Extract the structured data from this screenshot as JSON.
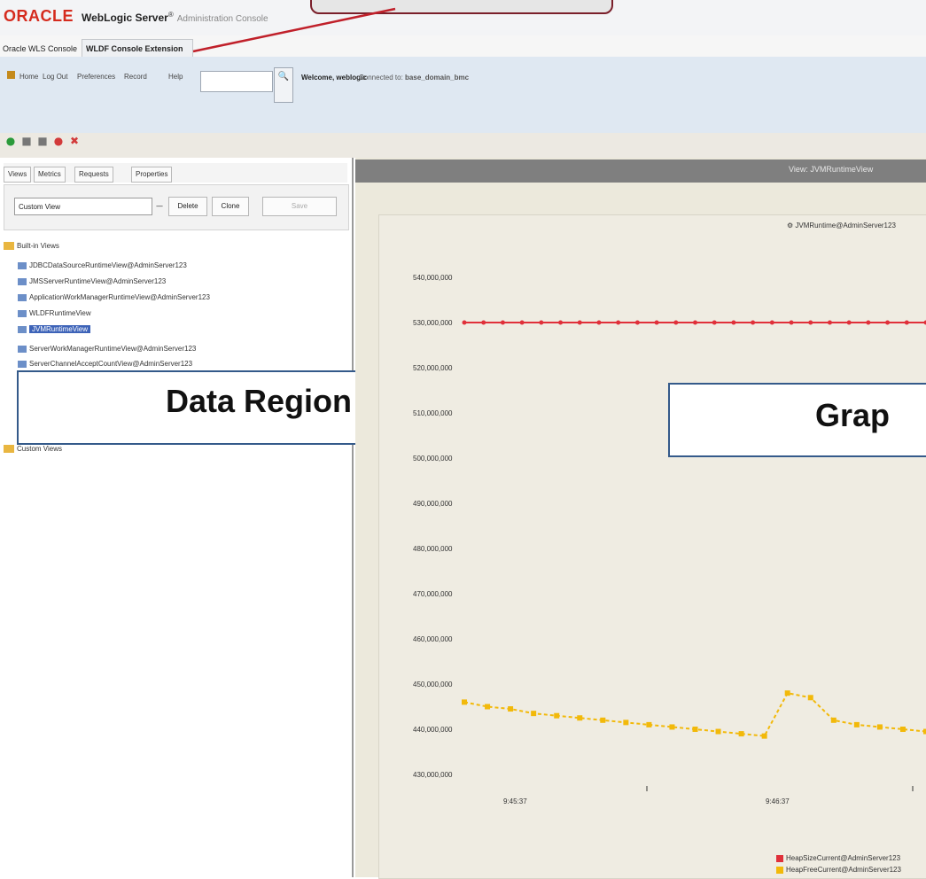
{
  "header": {
    "logo": "ORACLE",
    "product": "WebLogic Server",
    "product_sup": "®",
    "product_sub": "Administration Console"
  },
  "tabs": [
    {
      "label": "Oracle WLS Console"
    },
    {
      "label": "WLDF Console Extension"
    }
  ],
  "toolbar": {
    "links": [
      "Home",
      "Log Out",
      "Preferences",
      "Record",
      "Help"
    ],
    "search_value": "",
    "welcome": "Welcome, weblogic",
    "connected_label": "Connected to:",
    "connected_value": "base_domain_bmc"
  },
  "left": {
    "tabs": [
      "Views",
      "Metrics",
      "Requests",
      "Properties"
    ],
    "view_select": "Custom View",
    "buttons": [
      "Delete",
      "Clone",
      "Save"
    ],
    "tree": {
      "root": "Built-in Views",
      "items": [
        "JDBCDataSourceRuntimeView@AdminServer123",
        "JMSServerRuntimeView@AdminServer123",
        "ApplicationWorkManagerRuntimeView@AdminServer123",
        "WLDFRuntimeView",
        "JVMRuntimeView",
        "ServerWorkManagerRuntimeView@AdminServer123",
        "ServerChannelAcceptCountView@AdminServer123"
      ],
      "selected_index": 4,
      "root2": "Custom Views"
    },
    "overlay_label": "Data Region"
  },
  "right": {
    "title": "View: JVMRuntimeView",
    "overlay_label": "Grap",
    "chart_legend_top": "JVMRuntime@AdminServer123"
  },
  "chart_data": {
    "type": "line",
    "title": "",
    "ylabel": "",
    "xlabel": "",
    "y_ticks": [
      "540,000,000",
      "530,000,000",
      "520,000,000",
      "510,000,000",
      "500,000,000",
      "490,000,000",
      "480,000,000",
      "470,000,000",
      "460,000,000",
      "450,000,000",
      "440,000,000",
      "430,000,000"
    ],
    "x_ticks": [
      "9:45:37",
      "9:46:37"
    ],
    "series": [
      {
        "name": "HeapSizeCurrent@AdminServer123",
        "color": "#e0303a",
        "values": [
          530,
          530,
          530,
          530,
          530,
          530,
          530,
          530,
          530,
          530,
          530,
          530,
          530,
          530,
          530,
          530,
          530,
          530,
          530,
          530,
          530,
          530,
          530,
          530,
          530
        ]
      },
      {
        "name": "HeapFreeCurrent@AdminServer123",
        "color": "#f2b90a",
        "values": [
          446,
          445,
          444.5,
          443.5,
          443,
          442.5,
          442,
          441.5,
          441,
          440.5,
          440,
          439.5,
          439,
          438.5,
          448,
          447,
          442,
          441,
          440.5,
          440,
          439.5
        ]
      }
    ],
    "legend_position": "bottom-right"
  }
}
